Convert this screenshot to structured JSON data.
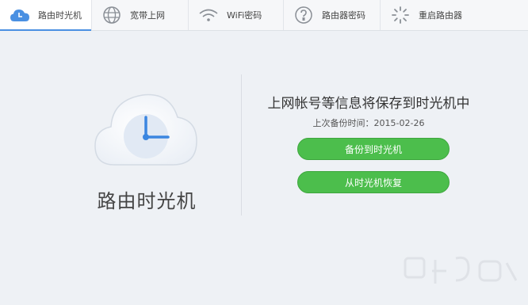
{
  "tabs": [
    {
      "label": "路由时光机",
      "icon": "cloud-clock-icon",
      "active": true
    },
    {
      "label": "宽带上网",
      "icon": "globe-icon",
      "active": false
    },
    {
      "label": "WiFi密码",
      "icon": "wifi-icon",
      "active": false
    },
    {
      "label": "路由器密码",
      "icon": "password-icon",
      "active": false
    },
    {
      "label": "重启路由器",
      "icon": "restart-spinner-icon",
      "active": false
    }
  ],
  "main": {
    "title": "路由时光机",
    "headline": "上网帐号等信息将保存到时光机中",
    "last_backup_label": "上次备份时间：",
    "last_backup_date": "2015-02-26",
    "backup_button": "备份到时光机",
    "restore_button": "从时光机恢复"
  },
  "colors": {
    "accent": "#4a90e2",
    "button_green": "#4cbe4c",
    "background": "#eef1f5"
  }
}
